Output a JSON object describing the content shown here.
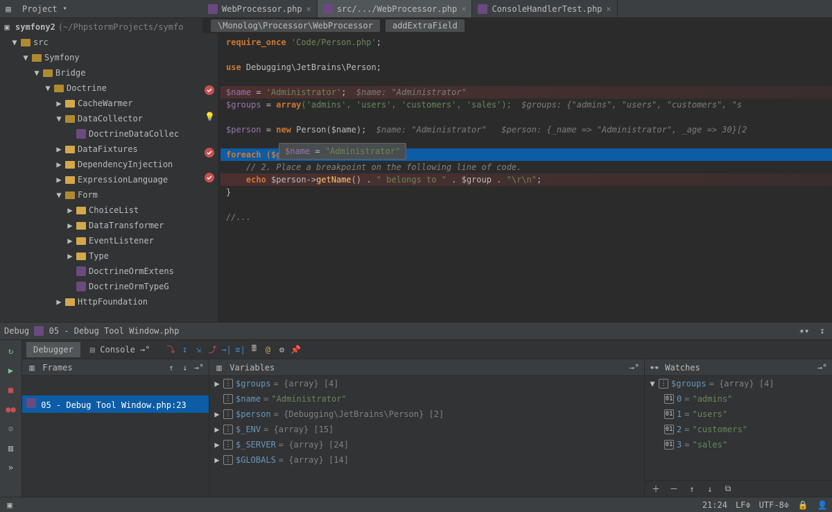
{
  "project": {
    "panel_label": "Project",
    "root": "symfony2",
    "root_path": "(~/PhpstormProjects/symfo",
    "tree": [
      {
        "d": 1,
        "t": "src",
        "open": true,
        "arrow": "▼"
      },
      {
        "d": 2,
        "t": "Symfony",
        "open": true,
        "arrow": "▼"
      },
      {
        "d": 3,
        "t": "Bridge",
        "open": true,
        "arrow": "▼"
      },
      {
        "d": 4,
        "t": "Doctrine",
        "open": true,
        "arrow": "▼"
      },
      {
        "d": 5,
        "t": "CacheWarmer",
        "arrow": "▶"
      },
      {
        "d": 5,
        "t": "DataCollector",
        "open": true,
        "arrow": "▼"
      },
      {
        "d": 6,
        "t": "DoctrineDataCollec",
        "file": true
      },
      {
        "d": 5,
        "t": "DataFixtures",
        "arrow": "▶"
      },
      {
        "d": 5,
        "t": "DependencyInjection",
        "arrow": "▶"
      },
      {
        "d": 5,
        "t": "ExpressionLanguage",
        "arrow": "▶"
      },
      {
        "d": 5,
        "t": "Form",
        "open": true,
        "arrow": "▼"
      },
      {
        "d": 6,
        "t": "ChoiceList",
        "arrow": "▶"
      },
      {
        "d": 6,
        "t": "DataTransformer",
        "arrow": "▶"
      },
      {
        "d": 6,
        "t": "EventListener",
        "arrow": "▶"
      },
      {
        "d": 6,
        "t": "Type",
        "arrow": "▶"
      },
      {
        "d": 6,
        "t": "DoctrineOrmExtens",
        "file": true
      },
      {
        "d": 6,
        "t": "DoctrineOrmTypeG",
        "file": true
      },
      {
        "d": 5,
        "t": "HttpFoundation",
        "arrow": "▶"
      }
    ]
  },
  "tabs": [
    {
      "label": "WebProcessor.php",
      "active": false
    },
    {
      "label": "src/.../WebProcessor.php",
      "active": true
    },
    {
      "label": "ConsoleHandlerTest.php",
      "active": false
    }
  ],
  "breadcrumb": {
    "ns": "\\Monolog\\Processor\\WebProcessor",
    "fn": "addExtraField"
  },
  "code": {
    "l1a": "require_once",
    "l1b": " 'Code/Person.php'",
    "l2a": "use",
    "l2b": " Debugging\\JetBrains\\Person;",
    "l3a": "$name",
    "l3b": " = ",
    "l3c": "'Administrator'",
    "l3h": "  $name: \"Administrator\"",
    "l4a": "$groups",
    "l4b": " = ",
    "l4c": "array",
    "l4d": "('admins', 'users', 'customers', 'sales');",
    "l4h": "  $groups: {\"admins\", \"users\", \"customers\", \"s",
    "l5a": "$person",
    "l5b": " = ",
    "l5c": "new",
    "l5d": " Person",
    "l5e": "($name);",
    "l5h": "  $name: \"Administrator\"   $person: {_name => \"Administrator\", _age => 30}[2",
    "l6": "foreach ($g",
    "l7": "    // 2. Place a breakpoint on the following line of code.",
    "l8a": "    ",
    "l8b": "echo",
    "l8c": " $person->",
    "l8d": "getName",
    "l8e": "() . ",
    "l8f": "\" belongs to \"",
    "l8g": " . $group . ",
    "l8h": "\"\\r\\n\"",
    "l8i": ";",
    "l9": "}",
    "l10": "//...",
    "tooltip": "$name = \"Administrator\""
  },
  "debug": {
    "title_prefix": "Debug",
    "title": "05 - Debug Tool Window.php",
    "tabs": {
      "debugger": "Debugger",
      "console": "Console"
    },
    "frames": {
      "header": "Frames",
      "item": "05 - Debug Tool Window.php:23"
    },
    "variables": {
      "header": "Variables",
      "rows": [
        {
          "n": "$groups",
          "v": " = {array} [4]",
          "arrow": true
        },
        {
          "n": "$name",
          "v": " = ",
          "s": "\"Administrator\""
        },
        {
          "n": "$person",
          "v": " = {Debugging\\JetBrains\\Person} [2]",
          "arrow": true
        },
        {
          "n": "$_ENV",
          "v": " = {array} [15]",
          "arrow": true
        },
        {
          "n": "$_SERVER",
          "v": " = {array} [24]",
          "arrow": true
        },
        {
          "n": "$GLOBALS",
          "v": " = {array} [14]",
          "arrow": true
        }
      ]
    },
    "watches": {
      "header": "Watches",
      "root": {
        "n": "$groups",
        "v": " = {array} [4]"
      },
      "items": [
        {
          "k": "0",
          "v": "\"admins\""
        },
        {
          "k": "1",
          "v": "\"users\""
        },
        {
          "k": "2",
          "v": "\"customers\""
        },
        {
          "k": "3",
          "v": "\"sales\""
        }
      ]
    }
  },
  "status": {
    "caret": "21:24",
    "le": "LF≑",
    "enc": "UTF-8≑"
  }
}
